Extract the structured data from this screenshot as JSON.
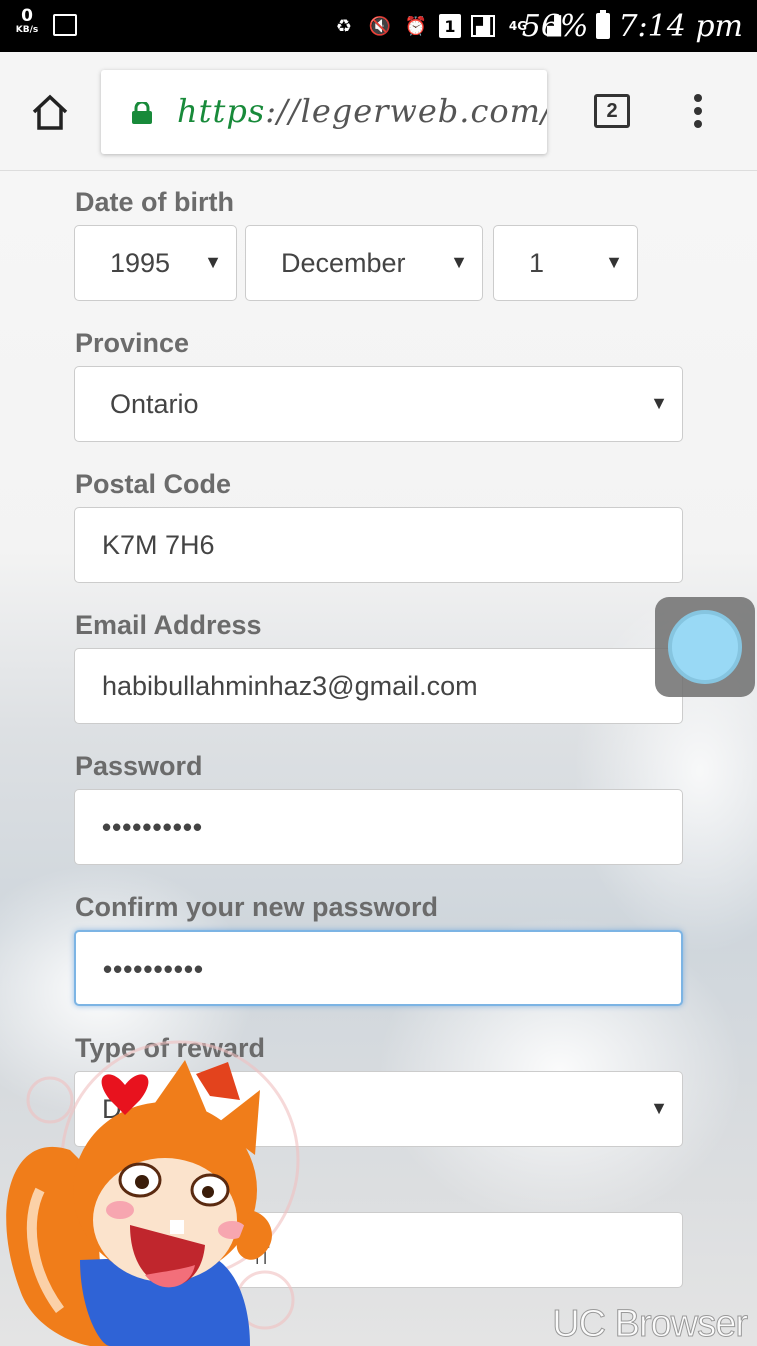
{
  "status_bar": {
    "speed_value": "0",
    "speed_unit": "KB/s",
    "sim_label": "1",
    "network": "4G",
    "battery": "56%",
    "time": "7:14 pm"
  },
  "browser": {
    "url_scheme": "https",
    "url_rest": "://legerweb.com/t",
    "tab_count": "2"
  },
  "form": {
    "dob_label": "Date of birth",
    "dob_year": "1995",
    "dob_month": "December",
    "dob_day": "1",
    "province_label": "Province",
    "province_value": "Ontario",
    "postal_label": "Postal Code",
    "postal_value": "K7M 7H6",
    "email_label": "Email Address",
    "email_value": "habibullahminhaz3@gmail.com",
    "password_label": "Password",
    "password_value": "••••••••••",
    "confirm_label": "Confirm your new password",
    "confirm_value": "••••••••••",
    "reward_label": "Type of reward",
    "reward_value": "D",
    "last_field_value": "না"
  },
  "watermark": "UC Browser",
  "colors": {
    "https_green": "#188a3a",
    "focus_border": "#7cb4e4",
    "label_gray": "#6b6b6b"
  }
}
